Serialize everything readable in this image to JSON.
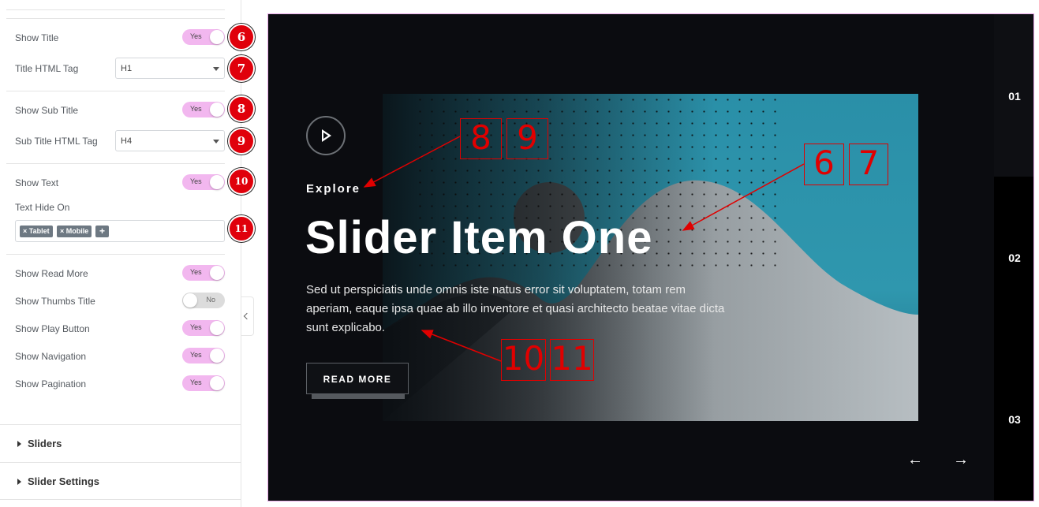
{
  "panel": {
    "rows": [
      {
        "label": "Show Title",
        "value": "Yes",
        "badge": "6"
      },
      {
        "label": "Title HTML Tag",
        "value": "H1",
        "badge": "7"
      },
      {
        "label": "Show Sub Title",
        "value": "Yes",
        "badge": "8"
      },
      {
        "label": "Sub Title HTML Tag",
        "value": "H4",
        "badge": "9"
      },
      {
        "label": "Show Text",
        "value": "Yes",
        "badge": "10"
      },
      {
        "label": "Text Hide On",
        "badge": "11"
      },
      {
        "label": "Show Read More",
        "value": "Yes"
      },
      {
        "label": "Show Thumbs Title",
        "value": "No"
      },
      {
        "label": "Show Play Button",
        "value": "Yes"
      },
      {
        "label": "Show Navigation",
        "value": "Yes"
      },
      {
        "label": "Show Pagination",
        "value": "Yes"
      }
    ],
    "tags": [
      "× Tablet",
      "× Mobile"
    ],
    "tag_add": "+",
    "sections": [
      "Sliders",
      "Slider Settings"
    ]
  },
  "slide": {
    "sub_title": "Explore",
    "title": "Slider Item One",
    "text": "Sed ut perspiciatis unde omnis iste natus error sit voluptatem, totam rem aperiam, eaque ipsa quae ab illo inventore et quasi architecto beatae vitae dicta sunt explicabo.",
    "read_more": "READ MORE"
  },
  "pagination": [
    "01",
    "02",
    "03"
  ],
  "navigation": {
    "prev": "←",
    "next": "→"
  },
  "annotations": [
    "8",
    "9",
    "6",
    "7",
    "10",
    "11"
  ],
  "colors": {
    "toggle_on": "#f2b7ef",
    "badge": "#e0000b",
    "preview_border": "#e8a9e8",
    "annotation": "#e00000"
  }
}
